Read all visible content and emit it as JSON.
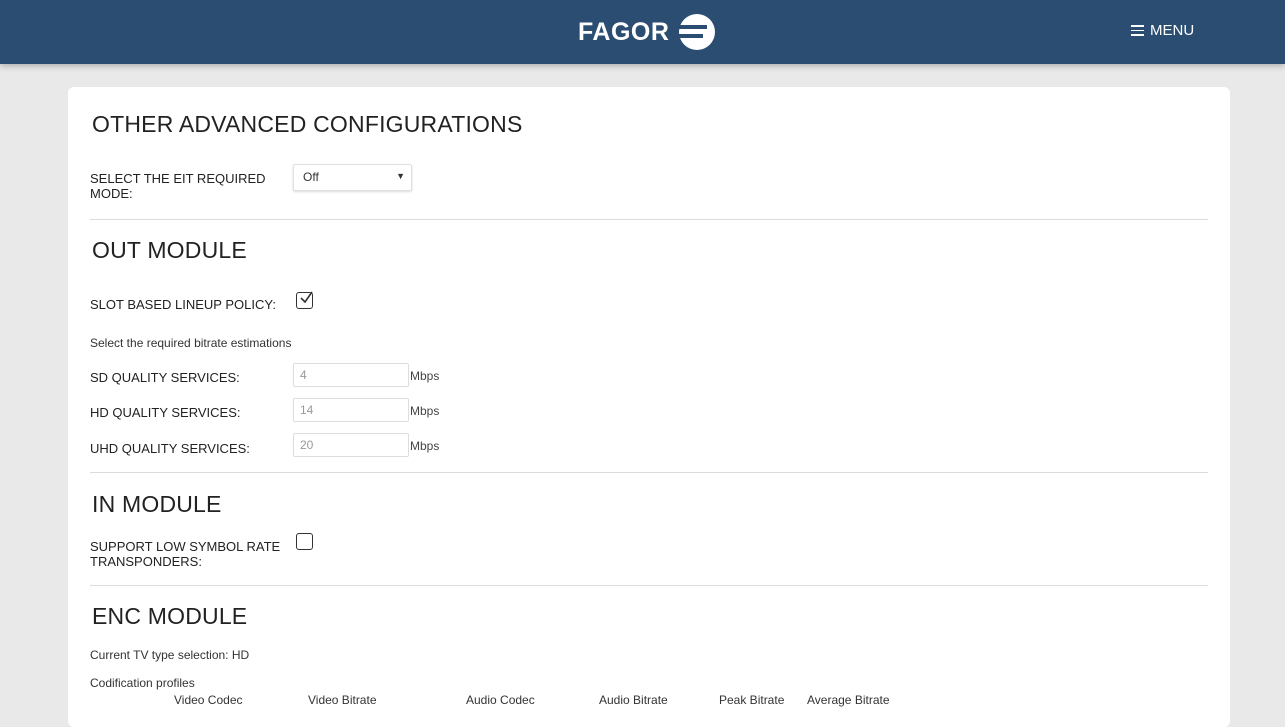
{
  "header": {
    "logo_text": "FAGOR",
    "menu_label": "MENU",
    "bg_color": "#2b4d72"
  },
  "advanced": {
    "title": "OTHER ADVANCED CONFIGURATIONS",
    "eit_label_line1": "SELECT THE EIT REQUIRED",
    "eit_label_line2": "MODE:",
    "eit_value": "Off"
  },
  "out_module": {
    "title": "OUT MODULE",
    "slot_label": "SLOT BASED LINEUP POLICY:",
    "slot_checked": true,
    "bitrate_hint": "Select the required bitrate estimations",
    "rows": [
      {
        "label": "SD QUALITY SERVICES:",
        "value": "4",
        "unit": "Mbps"
      },
      {
        "label": "HD QUALITY SERVICES:",
        "value": "14",
        "unit": "Mbps"
      },
      {
        "label": "UHD QUALITY SERVICES:",
        "value": "20",
        "unit": "Mbps"
      }
    ]
  },
  "in_module": {
    "title": "IN MODULE",
    "low_symbol_line1": "SUPPORT LOW SYMBOL RATE",
    "low_symbol_line2": "TRANSPONDERS:",
    "low_symbol_checked": false
  },
  "enc_module": {
    "title": "ENC MODULE",
    "tv_type": "Current TV type selection: HD",
    "profiles_label": "Codification profiles",
    "columns": [
      "Video Codec",
      "Video Bitrate",
      "Audio Codec",
      "Audio Bitrate",
      "Peak Bitrate",
      "Average Bitrate"
    ]
  }
}
